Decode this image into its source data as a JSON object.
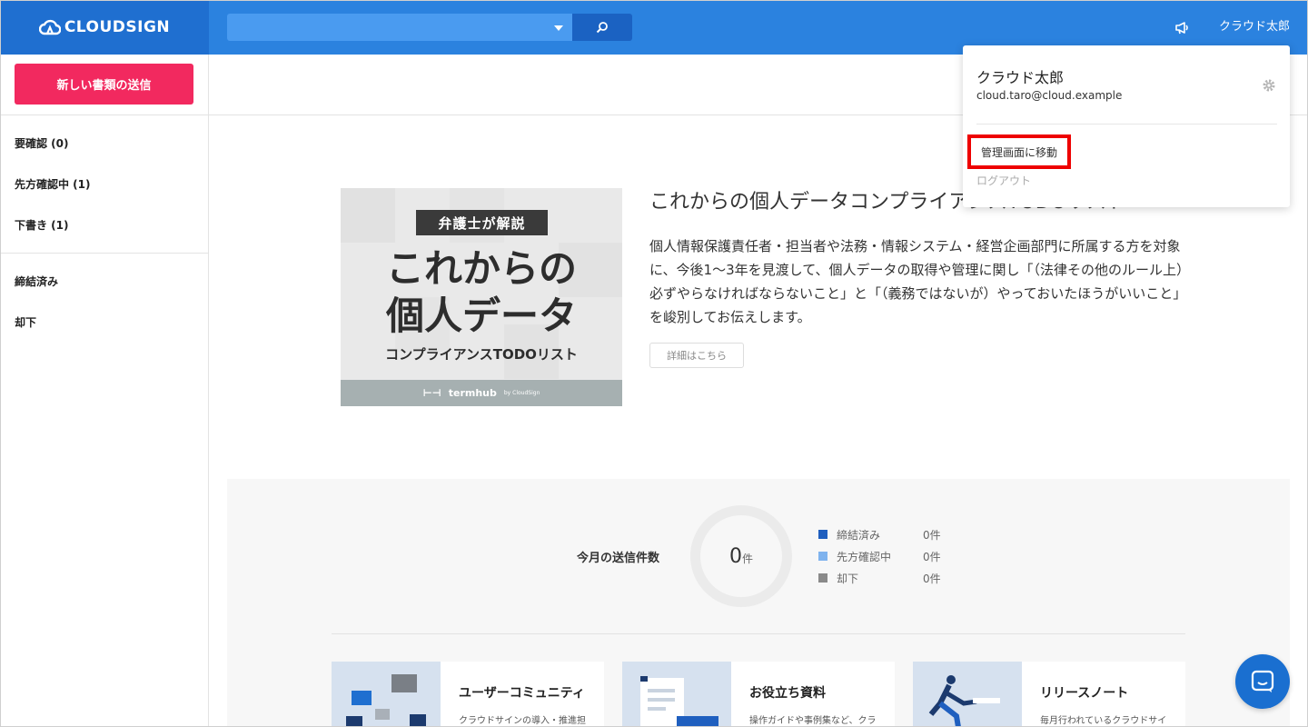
{
  "header": {
    "logo_text": "CLOUDSIGN",
    "search_placeholder": "",
    "user_name": "クラウド太郎"
  },
  "sidebar": {
    "new_doc_label": "新しい書類の送信",
    "items": [
      {
        "label": "要確認 (0)"
      },
      {
        "label": "先方確認中 (1)"
      },
      {
        "label": "下書き (1)"
      },
      {
        "label": "締結済み"
      },
      {
        "label": "却下"
      }
    ]
  },
  "banner": {
    "img_tag": "弁護士が解説",
    "img_line1": "これからの",
    "img_line2": "個人データ",
    "img_sub": "コンプライアンスTODOリスト",
    "img_brand": "termhub",
    "img_brand_by": "by CloudSign",
    "title": "これからの個人データコンプライアンスTODOリスト",
    "description": "個人情報保護責任者・担当者や法務・情報システム・経営企画部門に所属する方を対象に、今後1〜3年を見渡して、個人データの取得や管理に関し「（法律その他のルール上）必ずやらなければならないこと」と「（義務ではないが）やっておいたほうがいいこと」を峻別してお伝えします。",
    "detail_label": "詳細はこちら"
  },
  "stats": {
    "label": "今月の送信件数",
    "total": "0",
    "unit": "件",
    "legend": [
      {
        "name": "締結済み",
        "value": "0件",
        "color": "#1f5fbf"
      },
      {
        "name": "先方確認中",
        "value": "0件",
        "color": "#7fb3ee"
      },
      {
        "name": "却下",
        "value": "0件",
        "color": "#8a8a8a"
      }
    ]
  },
  "cards": [
    {
      "title": "ユーザーコミュニティ",
      "text": "クラウドサインの導入・推進担"
    },
    {
      "title": "お役立ち資料",
      "text": "操作ガイドや事例集など、クラ"
    },
    {
      "title": "リリースノート",
      "text": "毎月行われているクラウドサイ"
    }
  ],
  "dropdown": {
    "name": "クラウド太郎",
    "email": "cloud.taro@cloud.example",
    "admin_label": "管理画面に移動",
    "logout_label": "ログアウト"
  },
  "icons": {
    "search": "search-icon",
    "megaphone": "megaphone-icon",
    "gear": "gear-icon",
    "chat": "chat-icon"
  }
}
